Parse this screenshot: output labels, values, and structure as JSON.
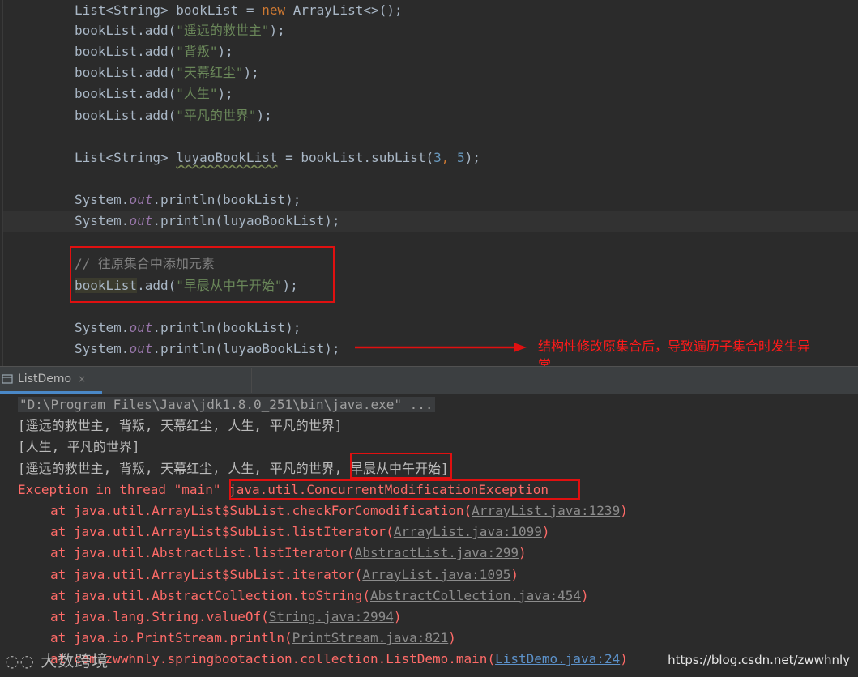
{
  "editor": {
    "lines": [
      {
        "id": "l1",
        "parts": [
          [
            "",
            "List<String> bookList = "
          ],
          [
            "kw",
            "new"
          ],
          [
            "",
            " ArrayList<>();"
          ]
        ]
      },
      {
        "id": "l2",
        "parts": [
          [
            "",
            "bookList.add("
          ],
          [
            "str",
            "\"遥远的救世主\""
          ],
          [
            "",
            ");"
          ]
        ]
      },
      {
        "id": "l3",
        "parts": [
          [
            "",
            "bookList.add("
          ],
          [
            "str",
            "\"背叛\""
          ],
          [
            "",
            ");"
          ]
        ]
      },
      {
        "id": "l4",
        "parts": [
          [
            "",
            "bookList.add("
          ],
          [
            "str",
            "\"天幕红尘\""
          ],
          [
            "",
            ");"
          ]
        ]
      },
      {
        "id": "l5",
        "parts": [
          [
            "",
            "bookList.add("
          ],
          [
            "str",
            "\"人生\""
          ],
          [
            "",
            ");"
          ]
        ]
      },
      {
        "id": "l6",
        "parts": [
          [
            "",
            "bookList.add("
          ],
          [
            "str",
            "\"平凡的世界\""
          ],
          [
            "",
            ");"
          ]
        ]
      },
      {
        "id": "l7",
        "parts": [
          [
            "",
            "List<String> "
          ],
          [
            "wavy",
            "luyaoBookList"
          ],
          [
            "",
            " = bookList.subList("
          ],
          [
            "num",
            "3"
          ],
          [
            "kw",
            ","
          ],
          [
            "",
            " "
          ],
          [
            "num",
            "5"
          ],
          [
            "",
            ");"
          ]
        ]
      },
      {
        "id": "l8",
        "parts": [
          [
            "",
            "System."
          ],
          [
            "fld",
            "out"
          ],
          [
            "",
            ".println(bookList);"
          ]
        ]
      },
      {
        "id": "l9",
        "parts": [
          [
            "",
            "System."
          ],
          [
            "fld",
            "out"
          ],
          [
            "",
            ".println(luyaoBookList);"
          ]
        ]
      },
      {
        "id": "l10",
        "parts": [
          [
            "cmt",
            "// 往原集合中添加元素"
          ]
        ]
      },
      {
        "id": "l11",
        "parts": [
          [
            "hl-var",
            "bookList"
          ],
          [
            "",
            ".add("
          ],
          [
            "str",
            "\"早晨从中午开始\""
          ],
          [
            "",
            ");"
          ]
        ]
      },
      {
        "id": "l12",
        "parts": [
          [
            "",
            "System."
          ],
          [
            "fld",
            "out"
          ],
          [
            "",
            ".println(bookList);"
          ]
        ]
      },
      {
        "id": "l13",
        "parts": [
          [
            "",
            "System."
          ],
          [
            "fld",
            "out"
          ],
          [
            "",
            ".println(luyaoBookList);"
          ]
        ]
      }
    ]
  },
  "annotation": {
    "text": "结构性修改原集合后，导致遍历子集合时发生异常"
  },
  "run_tab": {
    "label": "ListDemo",
    "close_glyph": "×"
  },
  "console": {
    "command": "\"D:\\Program Files\\Java\\jdk1.8.0_251\\bin\\java.exe\" ...",
    "output_1": "[遥远的救世主, 背叛, 天幕红尘, 人生, 平凡的世界]",
    "output_2": "[人生, 平凡的世界]",
    "output_3_prefix": "[遥远的救世主, 背叛, 天幕红尘, 人生, 平凡的世界, ",
    "output_3_highlight": "早晨从中午开始]",
    "exception_prefix": "Exception in thread \"main\" ",
    "exception_class": "java.util.ConcurrentModificationException",
    "trace": [
      {
        "at": "at java.util.ArrayList$SubList.checkForComodification(",
        "link": "ArrayList.java:1239",
        "end": ")",
        "style": "gray"
      },
      {
        "at": "at java.util.ArrayList$SubList.listIterator(",
        "link": "ArrayList.java:1099",
        "end": ")",
        "style": "gray"
      },
      {
        "at": "at java.util.AbstractList.listIterator(",
        "link": "AbstractList.java:299",
        "end": ")",
        "style": "gray"
      },
      {
        "at": "at java.util.ArrayList$SubList.iterator(",
        "link": "ArrayList.java:1095",
        "end": ")",
        "style": "gray"
      },
      {
        "at": "at java.util.AbstractCollection.toString(",
        "link": "AbstractCollection.java:454",
        "end": ")",
        "style": "gray"
      },
      {
        "at": "at java.lang.String.valueOf(",
        "link": "String.java:2994",
        "end": ")",
        "style": "gray"
      },
      {
        "at": "at java.io.PrintStream.println(",
        "link": "PrintStream.java:821",
        "end": ")",
        "style": "gray"
      },
      {
        "at": "at com.zwwhnly.springbootaction.collection.ListDemo.main(",
        "link": "ListDemo.java:24",
        "end": ")",
        "style": "blue"
      }
    ]
  },
  "watermark": {
    "logo": "大数跨境",
    "url": "https://blog.csdn.net/zwwhnly"
  },
  "colors": {
    "error": "#ff6b68",
    "annotation": "#ff1a1a",
    "link": "#5c91c9"
  }
}
